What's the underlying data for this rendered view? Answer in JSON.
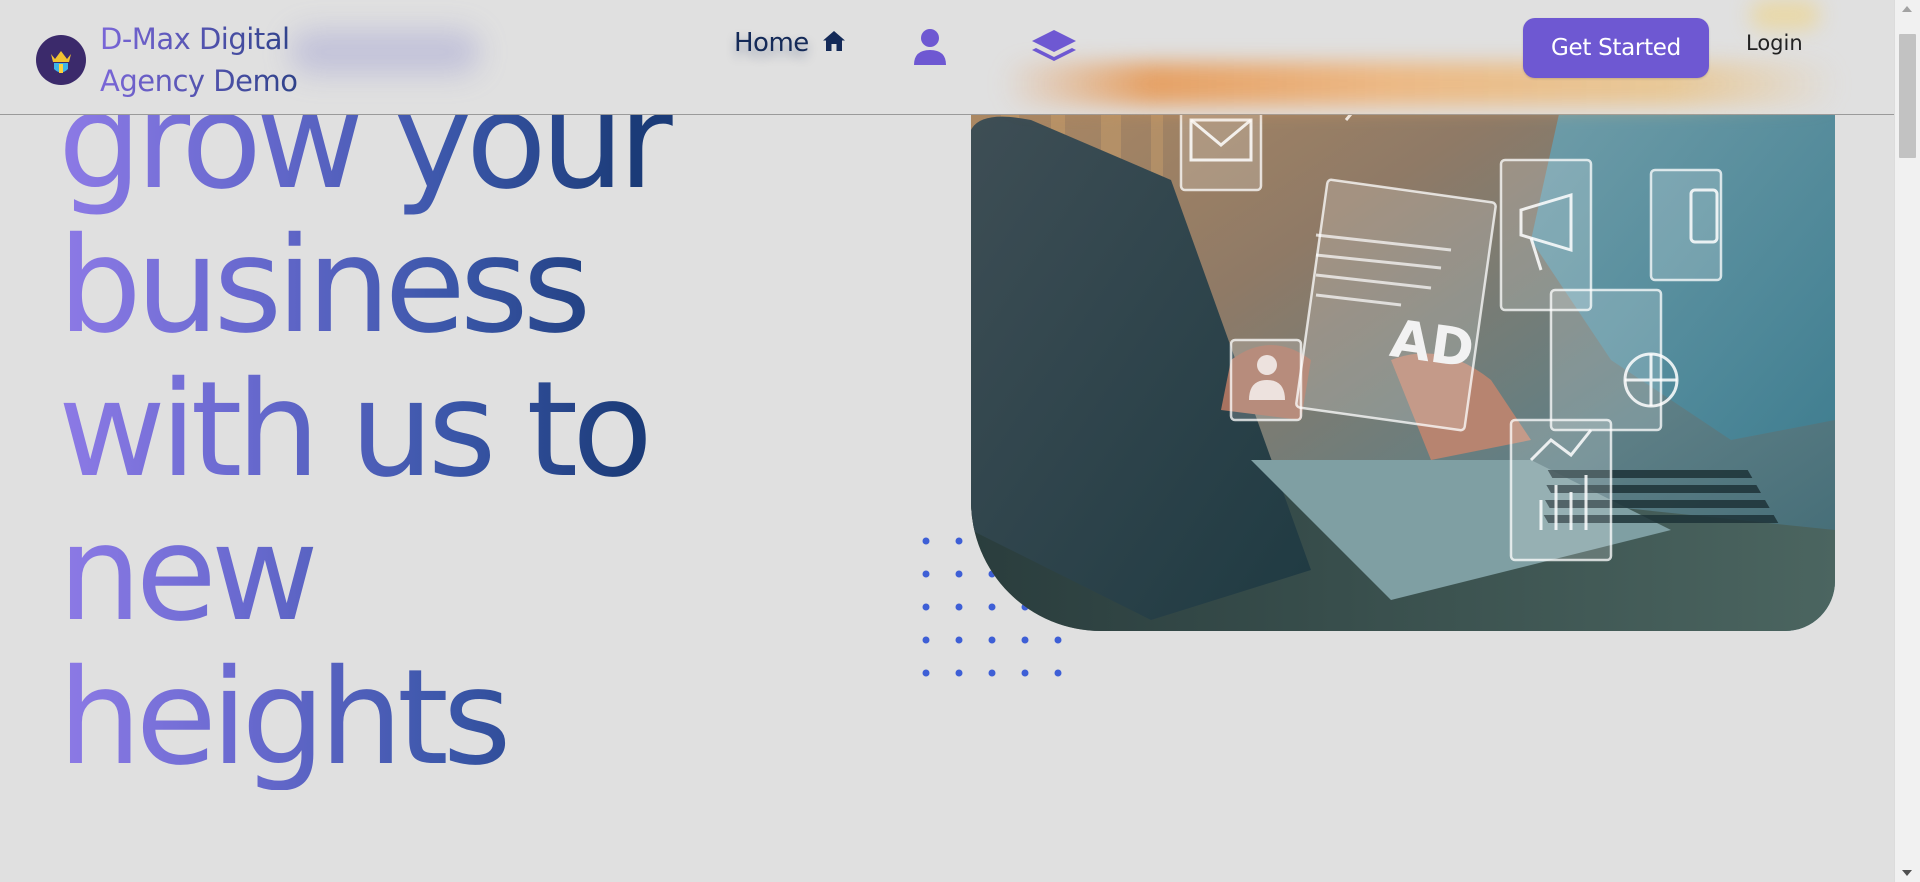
{
  "brand": {
    "name": "D-Max Digital Agency Demo",
    "logo_icon": "crown-shield-icon"
  },
  "nav": {
    "home_label": "Home",
    "home_icon": "home-icon",
    "profile_icon": "user-icon",
    "layers_icon": "layers-icon"
  },
  "actions": {
    "get_started_label": "Get Started",
    "login_label": "Login"
  },
  "hero": {
    "heading": "grow your business with us to new heights",
    "image_alt_text": "AD",
    "image_icons": [
      "mail-icon",
      "search-icon",
      "megaphone-icon",
      "phone-icon",
      "user-icon",
      "globe-icon",
      "bar-chart-icon"
    ]
  },
  "colors": {
    "accent": "#6e58d2",
    "heading_start": "#8d7ae6",
    "heading_end": "#1b3b78",
    "nav_text": "#142a58",
    "dots": "#3e5fd6",
    "background": "#e0e0e0"
  }
}
